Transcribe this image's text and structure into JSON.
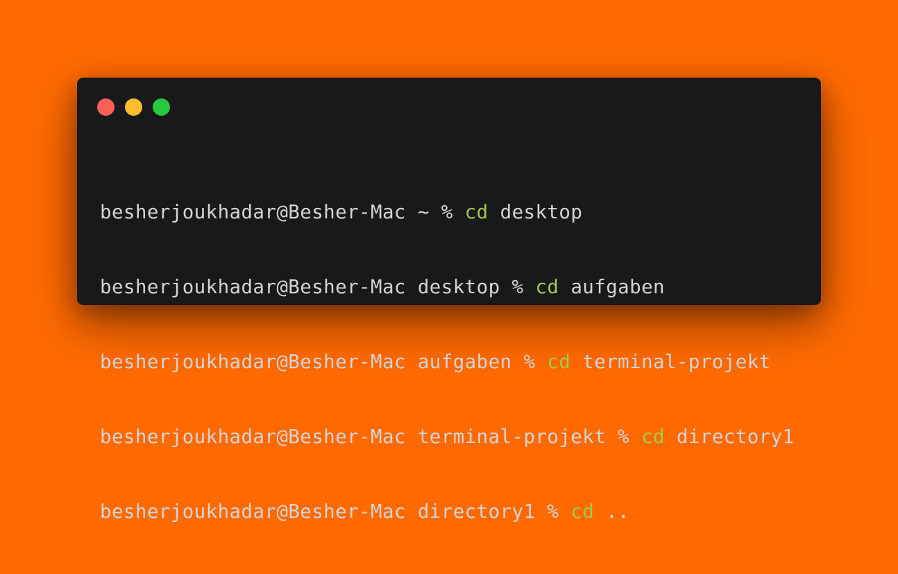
{
  "window": {
    "controls": [
      {
        "name": "close",
        "color": "#ff5f57"
      },
      {
        "name": "minimize",
        "color": "#febc2e"
      },
      {
        "name": "maximize",
        "color": "#28c840"
      }
    ]
  },
  "terminal": {
    "lines": [
      {
        "host": "besherjoukhadar@Besher-Mac",
        "dir": "~",
        "prompt": "%",
        "command": "cd",
        "arg": "desktop"
      },
      {
        "host": "besherjoukhadar@Besher-Mac",
        "dir": "desktop",
        "prompt": "%",
        "command": "cd",
        "arg": "aufgaben"
      },
      {
        "host": "besherjoukhadar@Besher-Mac",
        "dir": "aufgaben",
        "prompt": "%",
        "command": "cd",
        "arg": "terminal-projekt"
      },
      {
        "host": "besherjoukhadar@Besher-Mac",
        "dir": "terminal-projekt",
        "prompt": "%",
        "command": "cd",
        "arg": "directory1"
      },
      {
        "host": "besherjoukhadar@Besher-Mac",
        "dir": "directory1",
        "prompt": "%",
        "command": "cd",
        "arg": ".."
      }
    ]
  },
  "colors": {
    "background": "#ff6a00",
    "window": "#17191b",
    "text": "#d4d4d4",
    "command": "#a3c94a"
  }
}
